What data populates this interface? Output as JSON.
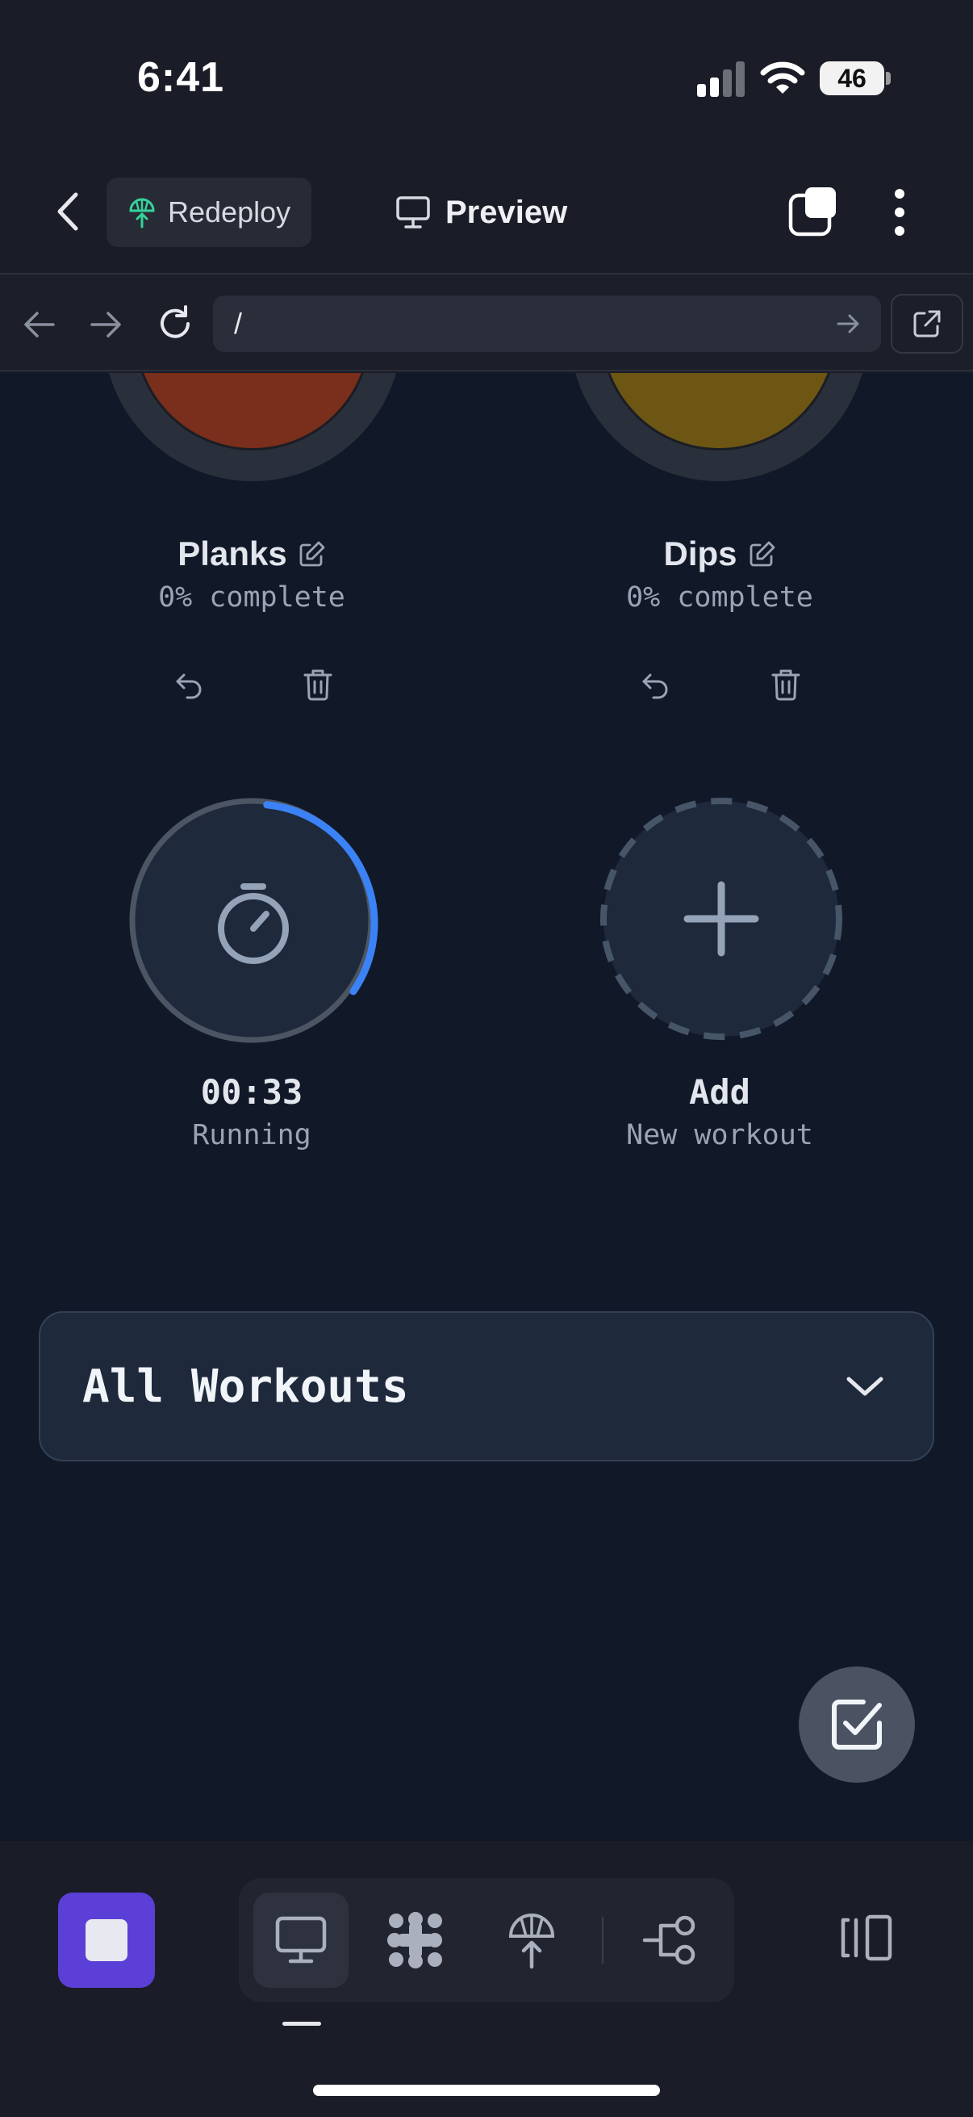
{
  "status_bar": {
    "time": "6:41",
    "battery": "46"
  },
  "header": {
    "redeploy_label": "Redeploy",
    "title": "Preview"
  },
  "browser": {
    "url": "/"
  },
  "workouts": [
    {
      "name": "Planks",
      "progress_text": "0% complete",
      "color": "#7a2e1c"
    },
    {
      "name": "Dips",
      "progress_text": "0% complete",
      "color": "#6d5614"
    }
  ],
  "timer": {
    "time": "00:33",
    "status": "Running",
    "progress_fraction": 0.33
  },
  "add_card": {
    "title": "Add",
    "subtitle": "New workout"
  },
  "accordion": {
    "label": "All Workouts"
  },
  "colors": {
    "accent": "#3b82f6",
    "stop_button": "#5b3fd6",
    "content_bg": "#111827",
    "app_bg": "#1a1d27"
  }
}
